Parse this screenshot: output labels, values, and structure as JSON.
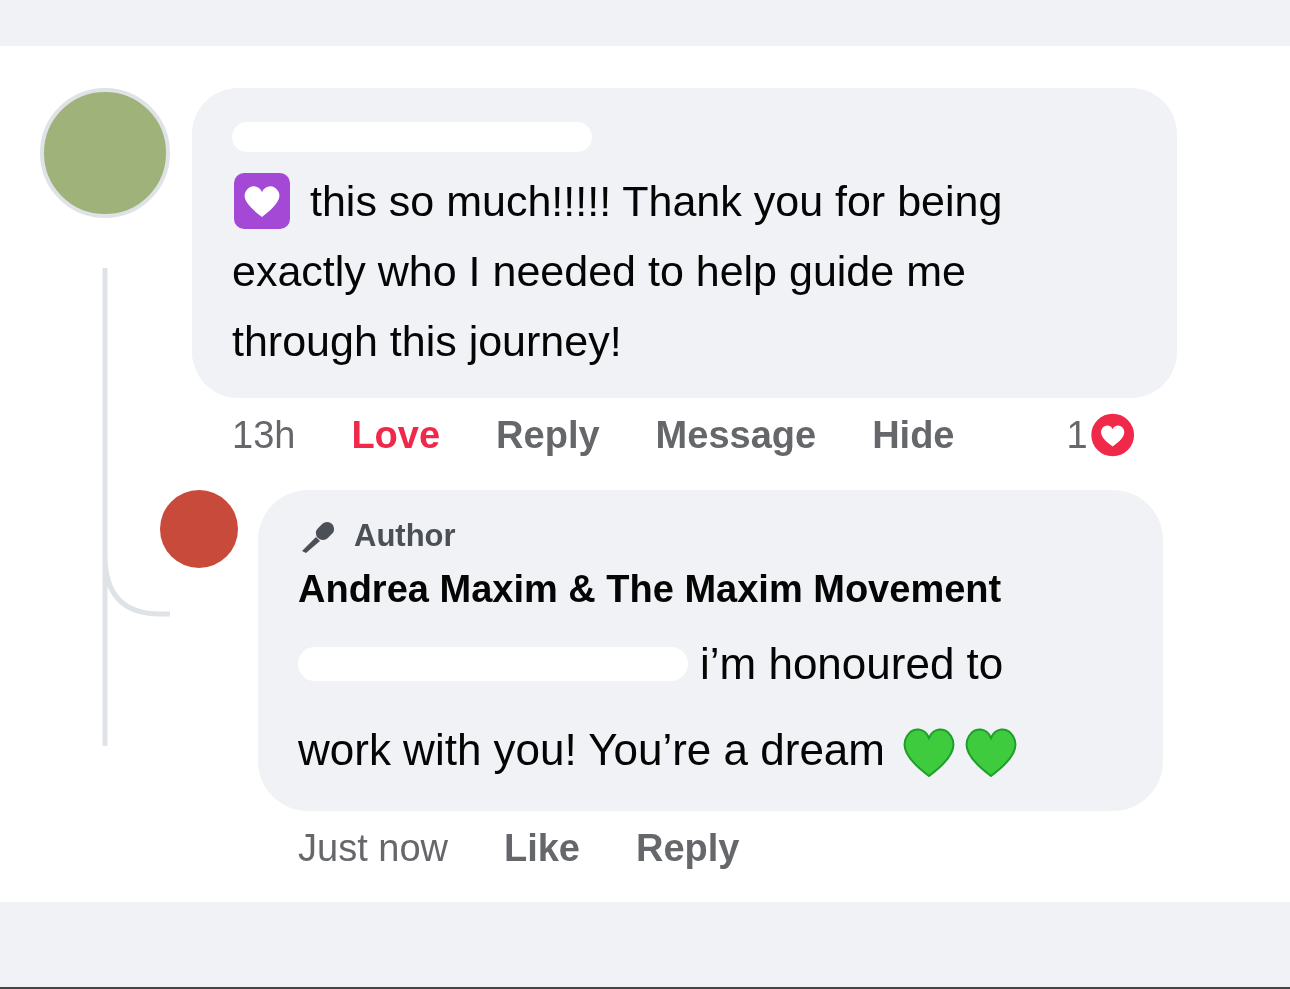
{
  "comment": {
    "lines": [
      "this so much!!!!! Thank you for being",
      "exactly who I needed to help guide me",
      "through this journey!"
    ],
    "time": "13h",
    "actions": [
      {
        "label": "Love",
        "selected": true
      },
      {
        "label": "Reply",
        "selected": false
      },
      {
        "label": "Message",
        "selected": false
      },
      {
        "label": "Hide",
        "selected": false
      }
    ],
    "reaction_count": "1"
  },
  "reply": {
    "badge": "Author",
    "author": "Andrea Maxim & The Maxim Movement",
    "lines": [
      "i’m honoured to",
      "work with you! You’re a dream"
    ],
    "time": "Just now",
    "actions": [
      {
        "label": "Like",
        "selected": false
      },
      {
        "label": "Reply",
        "selected": false
      }
    ]
  }
}
